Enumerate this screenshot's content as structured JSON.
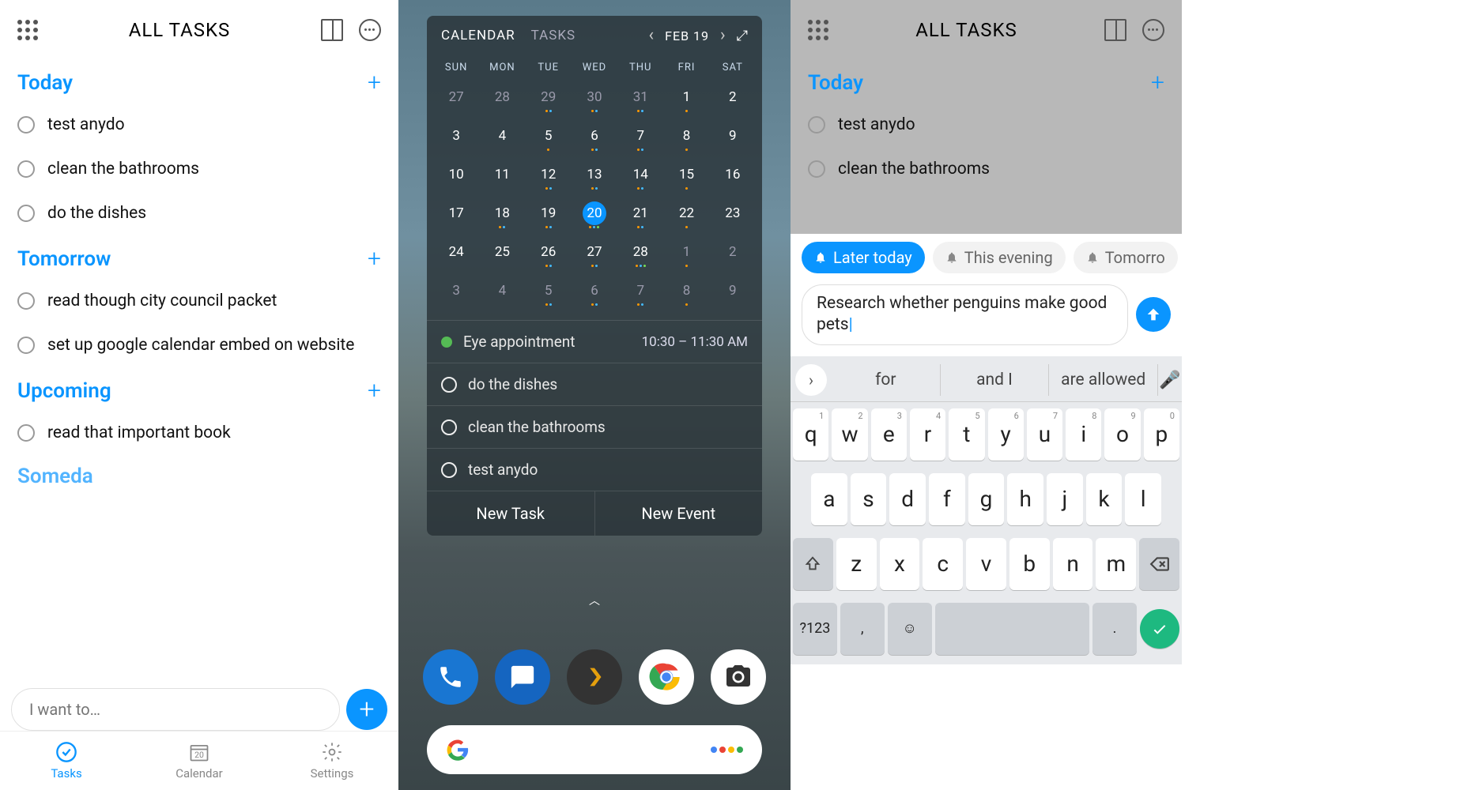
{
  "panel1": {
    "title": "ALL TASKS",
    "sections": [
      {
        "title": "Today",
        "tasks": [
          "test anydo",
          "clean the bathrooms",
          "do the dishes"
        ]
      },
      {
        "title": "Tomorrow",
        "tasks": [
          "read though city council packet",
          "set up google calendar embed on website"
        ]
      },
      {
        "title": "Upcoming",
        "tasks": [
          "read that important book"
        ]
      }
    ],
    "someday_label": "Someda",
    "input_placeholder": "I want to…",
    "tabs": {
      "tasks": "Tasks",
      "calendar": "Calendar",
      "calendar_date": "20",
      "settings": "Settings"
    }
  },
  "panel2": {
    "tabs": {
      "calendar": "CALENDAR",
      "tasks": "TASKS"
    },
    "date_label": "FEB 19",
    "dows": [
      "SUN",
      "MON",
      "TUE",
      "WED",
      "THU",
      "FRI",
      "SAT"
    ],
    "weeks": [
      [
        {
          "d": "27",
          "dim": true
        },
        {
          "d": "28",
          "dim": true
        },
        {
          "d": "29",
          "dim": true,
          "dots": 2
        },
        {
          "d": "30",
          "dim": true,
          "dots": 2
        },
        {
          "d": "31",
          "dim": true,
          "dots": 2
        },
        {
          "d": "1",
          "dots": 1
        },
        {
          "d": "2"
        }
      ],
      [
        {
          "d": "3"
        },
        {
          "d": "4"
        },
        {
          "d": "5",
          "dots": 1
        },
        {
          "d": "6",
          "dots": 2
        },
        {
          "d": "7",
          "dots": 2
        },
        {
          "d": "8",
          "dots": 1
        },
        {
          "d": "9"
        }
      ],
      [
        {
          "d": "10"
        },
        {
          "d": "11"
        },
        {
          "d": "12",
          "dots": 2
        },
        {
          "d": "13",
          "dots": 2
        },
        {
          "d": "14",
          "dots": 2
        },
        {
          "d": "15",
          "dots": 1
        },
        {
          "d": "16"
        }
      ],
      [
        {
          "d": "17"
        },
        {
          "d": "18",
          "dots": 2
        },
        {
          "d": "19",
          "dots": 2
        },
        {
          "d": "20",
          "sel": true,
          "dots": 3
        },
        {
          "d": "21",
          "dots": 2
        },
        {
          "d": "22",
          "dots": 1
        },
        {
          "d": "23"
        }
      ],
      [
        {
          "d": "24"
        },
        {
          "d": "25"
        },
        {
          "d": "26",
          "dots": 2
        },
        {
          "d": "27",
          "dots": 2
        },
        {
          "d": "28",
          "dots": 3
        },
        {
          "d": "1",
          "dim": true,
          "dots": 1
        },
        {
          "d": "2",
          "dim": true
        }
      ],
      [
        {
          "d": "3",
          "dim": true
        },
        {
          "d": "4",
          "dim": true
        },
        {
          "d": "5",
          "dim": true,
          "dots": 2
        },
        {
          "d": "6",
          "dim": true,
          "dots": 2
        },
        {
          "d": "7",
          "dim": true,
          "dots": 2
        },
        {
          "d": "8",
          "dim": true,
          "dots": 1
        },
        {
          "d": "9",
          "dim": true
        }
      ]
    ],
    "event": {
      "title": "Eye appointment",
      "time": "10:30 – 11:30 AM"
    },
    "widget_tasks": [
      "do the dishes",
      "clean the bathrooms",
      "test anydo"
    ],
    "actions": {
      "new_task": "New Task",
      "new_event": "New Event"
    }
  },
  "panel3": {
    "title": "ALL TASKS",
    "section_title": "Today",
    "tasks": [
      "test anydo",
      "clean the bathrooms"
    ],
    "chips": [
      "Later today",
      "This evening",
      "Tomorro"
    ],
    "task_input": "Research whether penguins make good pets",
    "suggestions": [
      "for",
      "and I",
      "are allowed"
    ],
    "row1": [
      [
        "q",
        "1"
      ],
      [
        "w",
        "2"
      ],
      [
        "e",
        "3"
      ],
      [
        "r",
        "4"
      ],
      [
        "t",
        "5"
      ],
      [
        "y",
        "6"
      ],
      [
        "u",
        "7"
      ],
      [
        "i",
        "8"
      ],
      [
        "o",
        "9"
      ],
      [
        "p",
        "0"
      ]
    ],
    "row2": [
      "a",
      "s",
      "d",
      "f",
      "g",
      "h",
      "j",
      "k",
      "l"
    ],
    "row3": [
      "z",
      "x",
      "c",
      "v",
      "b",
      "n",
      "m"
    ],
    "sym_key": "?123",
    "comma": ",",
    "period": "."
  }
}
